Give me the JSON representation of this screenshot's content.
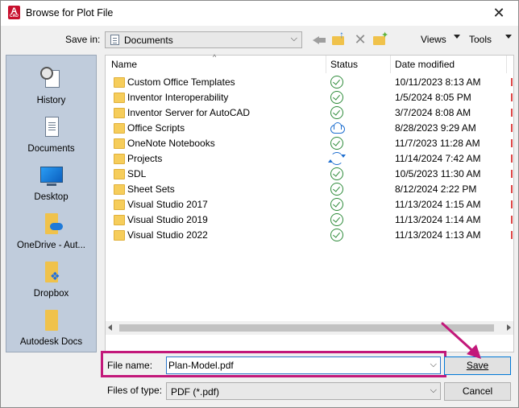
{
  "window": {
    "title": "Browse for Plot File",
    "close_glyph": "✕",
    "app_icon_letter": "A",
    "app_icon_sub": "CAD"
  },
  "toolbar": {
    "save_in_label": "Save in:",
    "save_in_value": "Documents",
    "views_label": "Views",
    "tools_label": "Tools",
    "delete_glyph": "✕",
    "combo_chevron": "⌵",
    "icons": [
      "back-arrow-icon",
      "up-folder-icon",
      "delete-icon",
      "new-folder-icon"
    ]
  },
  "places": [
    {
      "label": "History",
      "icon": "history-icon"
    },
    {
      "label": "Documents",
      "icon": "documents-icon"
    },
    {
      "label": "Desktop",
      "icon": "desktop-icon"
    },
    {
      "label": "OneDrive - Aut...",
      "icon": "onedrive-folder-icon"
    },
    {
      "label": "Dropbox",
      "icon": "dropbox-folder-icon"
    },
    {
      "label": "Autodesk Docs",
      "icon": "autodesk-docs-folder-icon"
    }
  ],
  "list": {
    "columns": {
      "name": "Name",
      "status": "Status",
      "date": "Date modified"
    },
    "sort_indicator": "^",
    "rows": [
      {
        "name": "Custom Office Templates",
        "status": "synced",
        "date": "10/11/2023 8:13 AM"
      },
      {
        "name": "Inventor Interoperability",
        "status": "synced",
        "date": "1/5/2024 8:05 PM"
      },
      {
        "name": "Inventor Server for AutoCAD",
        "status": "synced",
        "date": "3/7/2024 8:08 AM"
      },
      {
        "name": "Office Scripts",
        "status": "cloud",
        "date": "8/28/2023 9:29 AM"
      },
      {
        "name": "OneNote Notebooks",
        "status": "synced",
        "date": "11/7/2023 11:28 AM"
      },
      {
        "name": "Projects",
        "status": "syncing",
        "date": "11/14/2024 7:42 AM"
      },
      {
        "name": "SDL",
        "status": "synced",
        "date": "10/5/2023 11:30 AM"
      },
      {
        "name": "Sheet Sets",
        "status": "synced",
        "date": "8/12/2024 2:22 PM"
      },
      {
        "name": "Visual Studio 2017",
        "status": "synced",
        "date": "11/13/2024 1:15 AM"
      },
      {
        "name": "Visual Studio 2019",
        "status": "synced",
        "date": "11/13/2024 1:14 AM"
      },
      {
        "name": "Visual Studio 2022",
        "status": "synced",
        "date": "11/13/2024 1:13 AM"
      }
    ]
  },
  "bottom": {
    "file_name_label": "File name:",
    "file_name_value": "Plan-Model.pdf",
    "files_of_type_label": "Files of type:",
    "files_of_type_value": "PDF (*.pdf)",
    "save_button": "Save",
    "cancel_button": "Cancel"
  },
  "colors": {
    "highlight": "#c2187a",
    "status_ok": "#2e8b3a",
    "status_cloud": "#1f6fd0",
    "folder": "#f6cd5b"
  }
}
